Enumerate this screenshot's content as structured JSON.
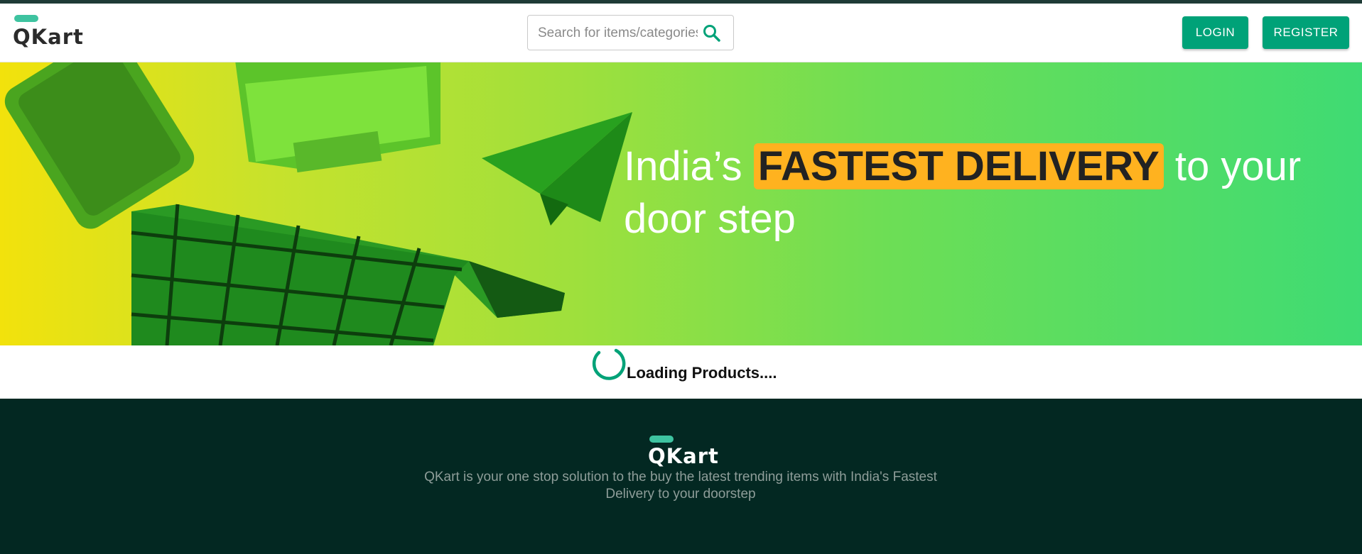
{
  "header": {
    "logo_text": "QKart",
    "search": {
      "placeholder": "Search for items/categories",
      "icon": "search-icon"
    },
    "login_label": "LOGIN",
    "register_label": "REGISTER"
  },
  "hero": {
    "headline_before": "India’s ",
    "headline_highlight": "FASTEST DELIVERY",
    "headline_after": " to your door step"
  },
  "loading": {
    "label": "Loading Products...."
  },
  "footer": {
    "logo_text": "QKart",
    "description": "QKart is your one stop solution to the buy the latest trending items with India's Fastest Delivery to your doorstep"
  },
  "colors": {
    "brand_green": "#00a278",
    "logo_accent": "#3ec3a0",
    "highlight": "#ffb21f",
    "footer_bg": "#032822"
  }
}
